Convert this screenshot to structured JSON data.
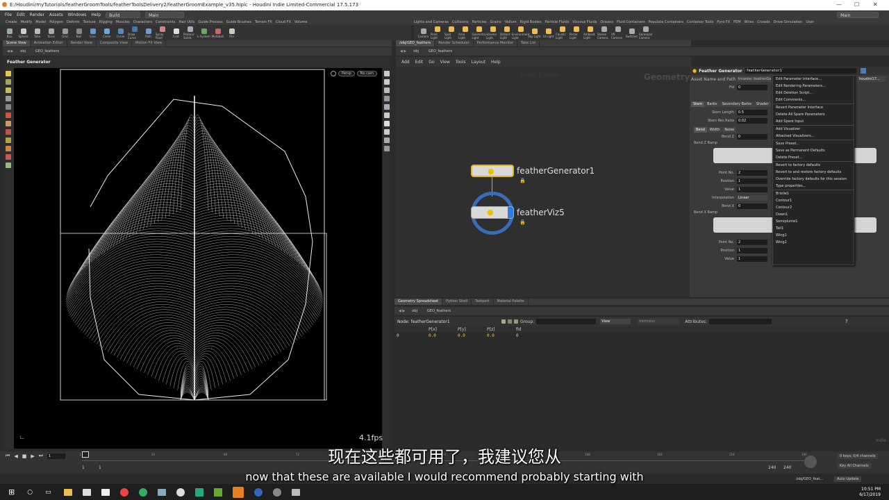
{
  "window": {
    "title": "E:/Houdini/myTutorials/featherGroomTools/featherToolsDelivery2/featherGroomExample_v35.hiplc - Houdini Indie Limited-Commercial 17.5.173"
  },
  "menubar": {
    "items": [
      "File",
      "Edit",
      "Render",
      "Assets",
      "Windows",
      "Help"
    ],
    "desktop_left": "Build",
    "desktop_main": "Main",
    "desktop_right": "Main"
  },
  "shelf_left": {
    "tabs": [
      "Create",
      "Modify",
      "Model",
      "Polygon",
      "Deform",
      "Texture",
      "Rigging",
      "Muscles",
      "Characters",
      "Constraints",
      "Hair Utils",
      "Guide Process",
      "Guide Brushes",
      "Terrain FX",
      "Cloud FX",
      "Volume"
    ],
    "tools": [
      {
        "label": "Box",
        "color": "#9aa"
      },
      {
        "label": "Sphere",
        "color": "#ccc"
      },
      {
        "label": "Tube",
        "color": "#bbb"
      },
      {
        "label": "Torus",
        "color": "#aaa"
      },
      {
        "label": "Grid",
        "color": "#999"
      },
      {
        "label": "Null",
        "color": "#888"
      },
      {
        "label": "Line",
        "color": "#69c"
      },
      {
        "label": "Circle",
        "color": "#6ad"
      },
      {
        "label": "Curve",
        "color": "#58b"
      },
      {
        "label": "Draw Curve",
        "color": "#47a"
      },
      {
        "label": "Path",
        "color": "#79c"
      },
      {
        "label": "Spray Paint",
        "color": "#c88"
      },
      {
        "label": "Font",
        "color": "#ddd"
      },
      {
        "label": "Platonic Solids",
        "color": "#aab"
      },
      {
        "label": "L-System",
        "color": "#6a6"
      },
      {
        "label": "Metaball",
        "color": "#c66"
      },
      {
        "label": "File",
        "color": "#ccb"
      }
    ]
  },
  "shelf_right": {
    "tabs": [
      "Lights and Cameras",
      "Collisions",
      "Particles",
      "Grains",
      "Vellum",
      "Rigid Bodies",
      "Particle Fluids",
      "Viscous Fluids",
      "Oceans",
      "Fluid Containers",
      "Populate Containers",
      "Container Tools",
      "Pyro FX",
      "FEM",
      "Wires",
      "Crowds",
      "Drive Simulation",
      "User"
    ],
    "tools": [
      {
        "label": "Camera",
        "color": "#aaa"
      },
      {
        "label": "Point Light",
        "color": "#eb5"
      },
      {
        "label": "Spot Light",
        "color": "#eb5"
      },
      {
        "label": "Area Light",
        "color": "#eb5"
      },
      {
        "label": "Geometry Light",
        "color": "#eb5"
      },
      {
        "label": "Volume Light",
        "color": "#eb5"
      },
      {
        "label": "Distant Light",
        "color": "#eb5"
      },
      {
        "label": "Environment Light",
        "color": "#eb5"
      },
      {
        "label": "Sky Light",
        "color": "#eb5"
      },
      {
        "label": "GI Light",
        "color": "#eb5"
      },
      {
        "label": "Caustic Light",
        "color": "#eb5"
      },
      {
        "label": "Portal Light",
        "color": "#eb5"
      },
      {
        "label": "Ambient Light",
        "color": "#eb5"
      },
      {
        "label": "Stereo Camera",
        "color": "#aaa"
      },
      {
        "label": "VR Camera",
        "color": "#aaa"
      },
      {
        "label": "Switcher",
        "color": "#aaa"
      },
      {
        "label": "Gamepad Camera",
        "color": "#aaa"
      }
    ]
  },
  "left_pane": {
    "tabs": [
      "Scene View",
      "Animation Editor",
      "Render View",
      "Composite View",
      "Motion FX View"
    ],
    "path": [
      "obj",
      "GEO_feathers"
    ],
    "viewport_title": "Feather Generator",
    "persp_label": "Persp",
    "cam_label": "No cam",
    "fps": "4.1fps"
  },
  "network_pane": {
    "tabs": [
      "/obj/GEO_feathers",
      "Render Scheduler",
      "Performance Monitor",
      "Take List"
    ],
    "path": [
      "obj",
      "GEO_feathers"
    ],
    "menu": [
      "Add",
      "Edit",
      "Go",
      "View",
      "Tools",
      "Layout",
      "Help"
    ],
    "watermark_left": "Indie Edition",
    "watermark_right": "Geometry",
    "nodes": [
      {
        "name": "featherGenerator1"
      },
      {
        "name": "featherViz5"
      }
    ]
  },
  "params": {
    "node_type": "Feather Generator",
    "node_name": "featherGenerator1",
    "asset_label": "Asset Name and Path",
    "asset_value": "tmanko::featherGe",
    "asset_right": "houdini17...",
    "fid_label": "Fid",
    "fid_value": "0",
    "tabs": [
      "Stem",
      "Barbs",
      "Secondary Barbs",
      "Shader"
    ],
    "stem_length_label": "Stem Length",
    "stem_length": "0.5",
    "stem_res_label": "Stem Res Ratio",
    "stem_res": "0.02",
    "subtabs": [
      "Bend",
      "Width",
      "Noise"
    ],
    "bendz_label": "Bend Z",
    "bendz": "0",
    "bendz_ramp": "Bend Z Ramp",
    "pointno_label": "Point No.",
    "pointno": "2",
    "position_label": "Position",
    "position": "1",
    "value_label": "Value",
    "value": "1",
    "interp_label": "Interpolation",
    "interp": "Linear",
    "bendx_label": "Bend X",
    "bendx": "0",
    "bendx_ramp": "Bend X Ramp",
    "pointno2": "2",
    "position2": "1",
    "value2": "1"
  },
  "context_menu": {
    "groups": [
      [
        "Edit Parameter Interface...",
        "Edit Rendering Parameters...",
        "Edit Deletion Script...",
        "Edit Comments..."
      ],
      [
        "Revert Parameter Interface",
        "Delete All Spare Parameters",
        "Add Spare Input"
      ],
      [
        "Add Visualizer",
        "Attached Visualizers..."
      ],
      [
        "Save Preset...",
        "Save as Permanent Defaults",
        "Delete Preset..."
      ],
      [
        "Revert to factory defaults",
        "Revert to and restore factory defaults",
        "Override factory defaults for this session",
        "Type properties..."
      ],
      [
        "Bristle1",
        "Contour1",
        "Contour2",
        "Down1",
        "Semiplume1",
        "Tail1",
        "Wing1",
        "Wing2"
      ]
    ]
  },
  "spreadsheet": {
    "tabs": [
      "Geometry Spreadsheet",
      "Python Shell",
      "Textport",
      "Material Palette"
    ],
    "path": [
      "obj",
      "GEO_feathers"
    ],
    "node_label": "Node: featherGenerator1",
    "group_label": "Group:",
    "view_label": "View",
    "intrinsics_label": "Intrinsics",
    "attributes_label": "Attributes:",
    "columns": [
      "",
      "P[x]",
      "P[y]",
      "P[z]",
      "fid"
    ],
    "rows": [
      [
        "0",
        "0.0",
        "0.0",
        "0.0",
        "0"
      ]
    ],
    "corner": "Indie"
  },
  "timeline": {
    "frame": "1",
    "start": "1",
    "start2": "1",
    "end": "240",
    "end2": "240",
    "ticks": [
      "1",
      "24",
      "48",
      "72",
      "96",
      "120",
      "144",
      "168",
      "192",
      "216",
      "240"
    ],
    "keys_label": "0 keys, 0/4 channels",
    "key_all": "Key All Channels",
    "path": "/obj/GEO_feat...",
    "auto_update": "Auto Update"
  },
  "caption": {
    "zh": "现在这些都可用了，我建议您从",
    "en": "now that these are available I would recommend probably starting with"
  },
  "taskbar": {
    "time": "10:51 PM",
    "date": "6/17/2019"
  }
}
